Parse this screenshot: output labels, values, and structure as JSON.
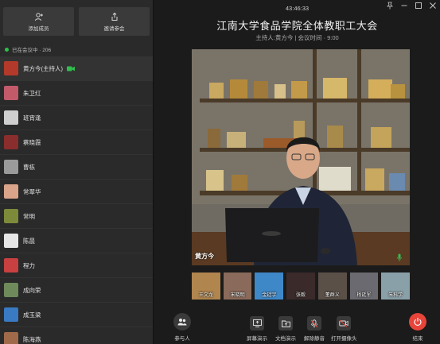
{
  "sidebar": {
    "add_member_label": "添加成员",
    "invite_label": "邀请参会",
    "status_text": "已在会议中 · 206",
    "members": [
      {
        "name": "黄方今(主持人)",
        "avatar_color": "#b33a2a",
        "camera_on": true
      },
      {
        "name": "朱卫红",
        "avatar_color": "#c25a6a"
      },
      {
        "name": "班宵逢",
        "avatar_color": "#cfcfcf"
      },
      {
        "name": "蔡晓霞",
        "avatar_color": "#8a2d2d"
      },
      {
        "name": "曹栋",
        "avatar_color": "#9a9a9a"
      },
      {
        "name": "常翠华",
        "avatar_color": "#d9a48a"
      },
      {
        "name": "常明",
        "avatar_color": "#7d8a3a"
      },
      {
        "name": "陈晨",
        "avatar_color": "#e6e6e6"
      },
      {
        "name": "程力",
        "avatar_color": "#c94040"
      },
      {
        "name": "成向荣",
        "avatar_color": "#6e8a5a"
      },
      {
        "name": "成玉梁",
        "avatar_color": "#3a7ac2"
      },
      {
        "name": "陈海燕",
        "avatar_color": "#a06a4a"
      }
    ]
  },
  "header": {
    "timer": "43:46:33",
    "title": "江南大学食品学院全体教职工大会",
    "subtitle": "主持人:黄方今 | 会议时间 · 9:00"
  },
  "video": {
    "speaker_name": "黄方今"
  },
  "thumbnails": [
    {
      "name": "王文龙",
      "color": "#b0854e"
    },
    {
      "name": "宋晓明",
      "color": "#8a6a5a"
    },
    {
      "name": "金廷宇",
      "color": "#3f88c8"
    },
    {
      "name": "张毅",
      "color": "#3a2a2a"
    },
    {
      "name": "董群义",
      "color": "#5a5048"
    },
    {
      "name": "杨廷军",
      "color": "#6a6a70"
    },
    {
      "name": "朱科学",
      "color": "#8aa0a8"
    }
  ],
  "toolbar": {
    "participants_label": "参与人",
    "screen_share_label": "屏幕演示",
    "doc_share_label": "文档演示",
    "unmute_label": "解除静音",
    "camera_label": "打开摄像头",
    "end_label": "结束"
  },
  "colors": {
    "end_red": "#e8443a",
    "online_green": "#2fbf4d"
  }
}
